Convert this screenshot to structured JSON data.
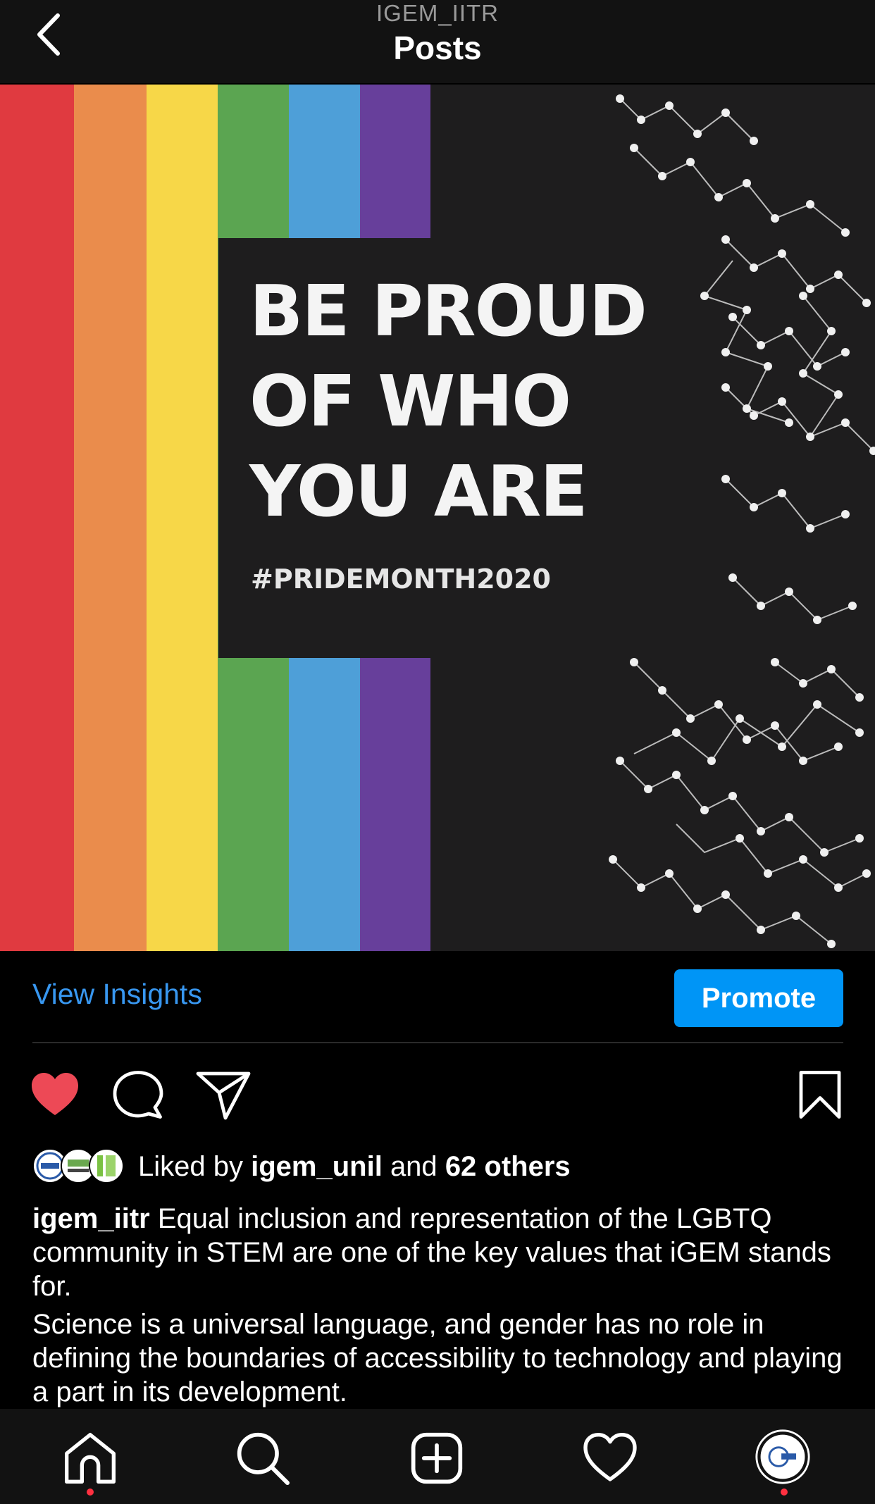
{
  "header": {
    "account": "IGEM_IITR",
    "title": "Posts"
  },
  "post_image": {
    "headline_lines": [
      "BE PROUD",
      "OF WHO",
      "YOU ARE"
    ],
    "hashtag": "#PRIDEMONTH2020",
    "stripe_colors": [
      "#e03a40",
      "#ea8c4c",
      "#f7d748",
      "#5ba551",
      "#4e9fd8",
      "#673f9b"
    ],
    "background_color": "#1e1d1e"
  },
  "insights": {
    "view_insights_label": "View Insights",
    "promote_label": "Promote"
  },
  "actions": {
    "like_icon": "heart-filled-icon",
    "comment_icon": "comment-icon",
    "share_icon": "paper-plane-icon",
    "save_icon": "bookmark-icon",
    "like_color": "#ed4956"
  },
  "likes": {
    "prefix": "Liked by",
    "first_user": "igem_unil",
    "conjunction": "and",
    "others": "62 others"
  },
  "caption": {
    "username": "igem_iitr",
    "paragraph1": "Equal inclusion and representation of the LGBTQ community in STEM are one of the key values that iGEM stands for.",
    "paragraph2": "Science is a universal language, and gender has no role in defining the boundaries of accessibility to technology and playing a part in its development."
  },
  "tabbar": {
    "items": [
      "home-icon",
      "search-icon",
      "new-post-icon",
      "activity-heart-icon",
      "profile-avatar"
    ],
    "notification_dot_color": "#ff3040"
  },
  "colors": {
    "accent": "#0095f6",
    "link": "#3897f0"
  }
}
